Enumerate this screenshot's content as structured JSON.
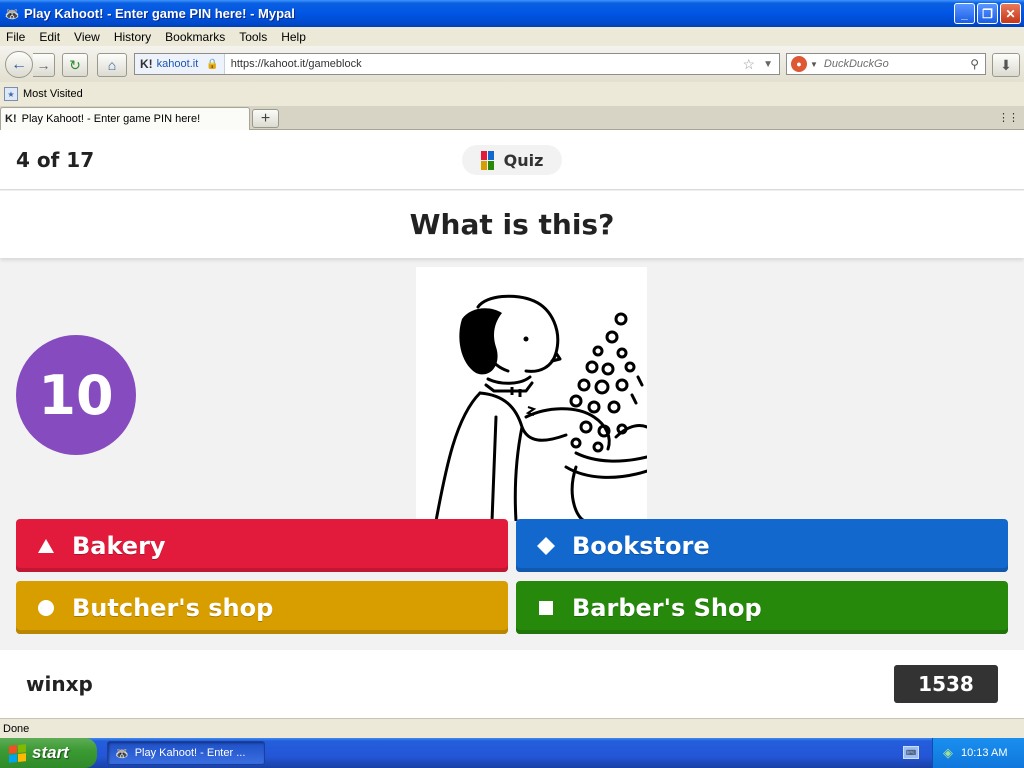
{
  "window": {
    "title": "Play Kahoot! - Enter game PIN here! - Mypal",
    "minimize_glyph": "_",
    "maximize_glyph": "❐",
    "close_glyph": "✕"
  },
  "menu": [
    "File",
    "Edit",
    "View",
    "History",
    "Bookmarks",
    "Tools",
    "Help"
  ],
  "nav": {
    "site_identity": "kahoot.it",
    "url": "https://kahoot.it/gameblock",
    "search_placeholder": "DuckDuckGo"
  },
  "bookmarks": {
    "most_visited": "Most Visited"
  },
  "tabs": [
    {
      "label": "Play Kahoot! - Enter game PIN here!",
      "active": true
    }
  ],
  "kahoot": {
    "progress": "4 of 17",
    "mode_label": "Quiz",
    "question": "What is this?",
    "timer": "10",
    "answers": [
      {
        "label": "Bakery",
        "shape": "triangle",
        "color": "#e21b3c"
      },
      {
        "label": "Bookstore",
        "shape": "diamond",
        "color": "#1368ce"
      },
      {
        "label": "Butcher's shop",
        "shape": "circle",
        "color": "#d89e00"
      },
      {
        "label": "Barber's Shop",
        "shape": "square",
        "color": "#26890c"
      }
    ],
    "player_name": "winxp",
    "score": "1538",
    "timer_color": "#864cbf"
  },
  "status": {
    "text": "Done"
  },
  "taskbar": {
    "start_label": "start",
    "task_item": "Play Kahoot! - Enter ...",
    "clock": "10:13 AM"
  }
}
